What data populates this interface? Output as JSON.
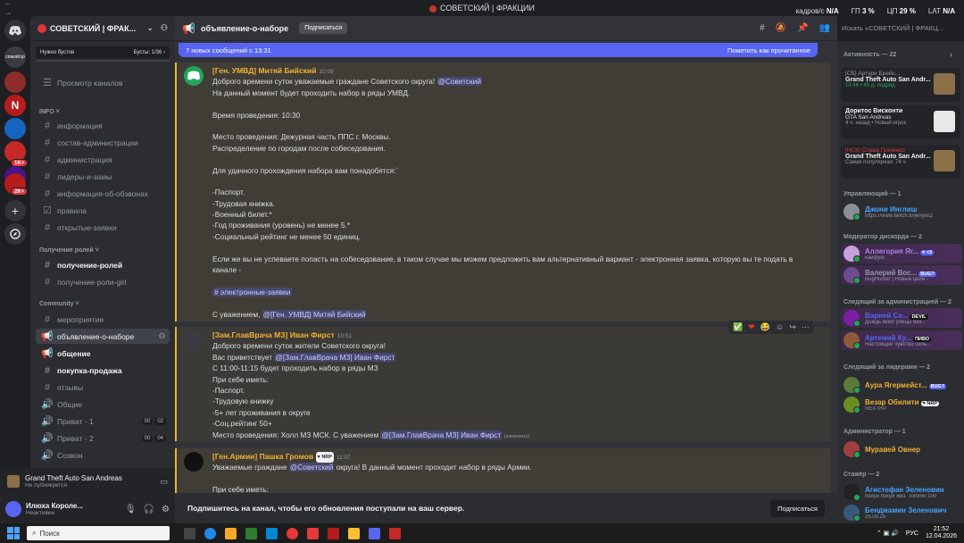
{
  "window": {
    "nav": "← →",
    "title": "СОВЕТСКИЙ | ФРАКЦИИ"
  },
  "hud": {
    "fps_label": "кадров/с",
    "fps": "N/A",
    "gpu_label": "ГП",
    "gpu": "3 %",
    "cpu_label": "ЦП",
    "cpu": "29 %",
    "lat_label": "LAT",
    "lat": "N/A"
  },
  "servers": {
    "badge1": "1K+",
    "badge2": "2K+",
    "add": "+",
    "label_top": "спакаКор"
  },
  "sidebar": {
    "server_name": "СОВЕТСКИЙ | ФРАК...",
    "boost_left": "Нужно бустов",
    "boost_right": "Бусты: 1/36 ›",
    "browse": "Просмотр каналов",
    "cat_info": "INFO ˅",
    "ch_info": "информация",
    "ch_staff": "состав-администрации",
    "ch_admin": "администрация",
    "ch_leaders": "лидеры-и-замы",
    "ch_calls": "информация-об-обзвонах",
    "ch_rules": "правила",
    "ch_open": "открытые-заявки",
    "cat_roles": "Получение ролей ˅",
    "ch_getroles": "получение-ролей",
    "ch_getgirl": "получение-роли-girl",
    "cat_comm": "Community ˅",
    "ch_events": "мероприятия",
    "ch_recruit": "объявление-о-наборе",
    "ch_chat": "общение",
    "ch_trade": "покупка-продажа",
    "ch_reviews": "отзывы",
    "ch_voice": "Общие",
    "ch_priv1": "Приват - 1",
    "ch_priv1_a": "00",
    "ch_priv1_b": "02",
    "ch_priv2": "Приват - 2",
    "ch_priv2_a": "00",
    "ch_priv2_b": "04",
    "ch_meet": "Созвон"
  },
  "activity": {
    "game": "Grand Theft Auto San Andreas",
    "status": "Не публикуется"
  },
  "user": {
    "name": "Илюха Короле...",
    "status": "Неактивен"
  },
  "header": {
    "channel": "объявление-о-наборе",
    "subscribe": "Подписаться",
    "search_placeholder": "Искать «СОВЕТСКИЙ | ФРАКЦ..."
  },
  "newbar": {
    "text": "7 новых сообщений с 13:31",
    "action": "Пометить как прочитанное"
  },
  "msg1": {
    "author": "[Ген. УМВД] Митяй Бийский",
    "time": "10:09",
    "l1": "Доброго времени суток уважаемые граждане Советского округа!",
    "l1_mention": "@Советский",
    "l2": "На данный момент будет проходить набор в ряды УМВД.",
    "l3": " Время проведения: 10:30",
    "l4": "Место проведения: Дежурная часть ППС г. Москвы.",
    "l5": "Распределение по городам после собеседования.",
    "l6": " Для удачного прохождения набора  вам понадобятся:`",
    "l7": "-Паспорт.",
    "l8": "-Трудовая книжка.",
    "l9": "-Военный билет.*",
    "l10": "-Год проживания (уровень) не менее 5.*",
    "l11": "-Социальный рейтинг не менее 50 единиц.",
    "l12": "Если же вы не успеваете попасть на собеседование, в таком случае мы можем предложить вам альтернативный вариант - электронная заявка, которую вы те подать в",
    "l13": "канале -",
    "l14": "# электронные-заявки",
    "l15": "С уважением,",
    "l15_mention": "@[Ген. УМВД] Митяй Бийский"
  },
  "msg2": {
    "author": "[Зам.ГлавВрача МЗ] Иван Фирст",
    "time": "10:51",
    "l1": "Доброго времени суток жители Советского округа!",
    "l2": "Вас приветствует",
    "l2_mention": "@[Зам.ГлавВрача МЗ] Иван Фирст",
    "l3": "С 11:00-11:15 будет проходить набор в ряды МЗ",
    "l4": "При себе иметь:",
    "l5": "-Паспорт.",
    "l6": "-Трудовую книжку",
    "l7": "-5+ лет проживания в округе",
    "l8": "-Соц.рейтинг 50+",
    "l9": "Место проведения: Холл МЗ МСК. С уважением",
    "l9_mention": "@[Зам.ГлавВрача МЗ] Иван Фирст",
    "edited": "(изменено)"
  },
  "msg3": {
    "author": "[Ген.Армии] Пашка Громов",
    "badge": "♥ NRP",
    "time": "11:07",
    "l1": "Уважаемые граждане",
    "l1_mention": "@Советский",
    "l1_rest": "округа! В данный момент проходит набор в ряды Армии.",
    "l2": "При себе иметь:"
  },
  "bottombar": {
    "text": "Подпишитесь на канал, чтобы его обновления поступали на ваш сервер.",
    "button": "Подписаться"
  },
  "members": {
    "activity_head": "Активность — 22",
    "a1_name": "[СБ] Артури Брейс...",
    "a1_game": "Grand Theft Auto San Andr...",
    "a1_meta": "19:46 • 45 д. подряд",
    "a2_name": "Доритос Висконти",
    "a2_game": "GTA San Andreas",
    "a2_meta": "4 ч. назад • Новый игрок",
    "a3_name": "[НСК] Слава Граченко",
    "a3_game": "Grand Theft Auto San Andr...",
    "a3_meta": "Самая популярная: 74 ч.",
    "h_manager": "Управляющий — 1",
    "m1_name": "Джони Инглиш",
    "m1_status": "https://www.twitch.tv/jenyesz",
    "h_mods": "Модератор дискорда — 2",
    "m2_name": "Аллегория Яг...",
    "m2_badge": "♥ <3",
    "m2_status": "кайфую",
    "m3_name": "Валерий Вос...",
    "m3_badge": "BUG?",
    "m3_status": "BugHunter | Новые цели -",
    "h_admin_follow": "Следящий за администрацией — 2",
    "m4_name": "Варней Се...",
    "m4_badge": "DEVIL",
    "m4_status": "Дождь моет улицы без...",
    "m5_name": "Артемий Ку...",
    "m5_badge": "ПИВО",
    "m5_status": "Настоящее чувство силь...",
    "h_leader_follow": "Следящий за лидерами — 2",
    "m6_name": "Аура Ягермейст...",
    "m6_badge": "BUG?",
    "m7_name": "Везар Обилити",
    "m7_badge": "♥ NRP",
    "m7_status": "NEXTRP",
    "h_admin": "Администратор — 1",
    "m8_name": "Муравей Овнер",
    "h_intern": "Стажёр — 2",
    "m9_name": "Агистефан Зеленовин",
    "m9_status": "похуй похуй жиз. Toronto 100",
    "m10_name": "Бенджамин Зеленович",
    "m10_status": "25.05.25"
  },
  "taskbar": {
    "search": "Поиск",
    "lang": "РУС",
    "time": "21:52",
    "date": "12.04.2026"
  },
  "colors": {
    "accent": "#5865f2",
    "highlight_border": "#f0b132",
    "online": "#23a55a"
  }
}
